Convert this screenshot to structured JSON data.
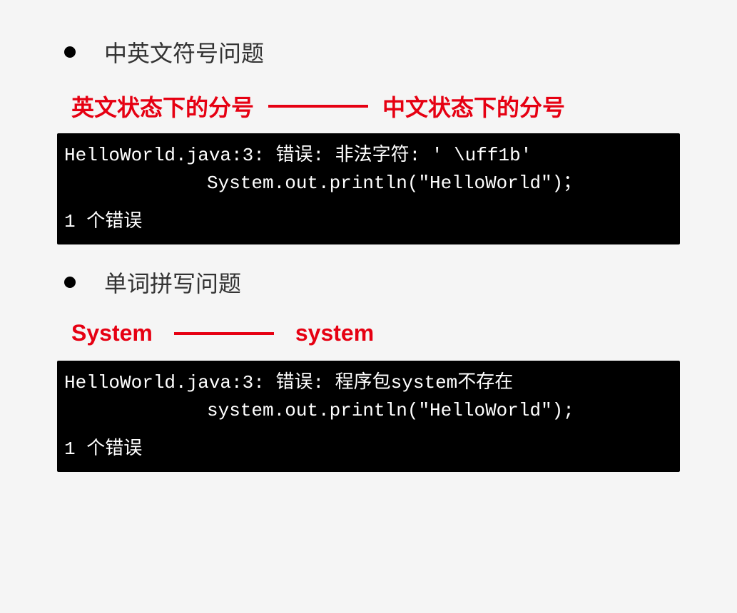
{
  "section1": {
    "bullet": "中英文符号问题",
    "left_label": "英文状态下的分号",
    "right_label": "中文状态下的分号",
    "terminal": {
      "line1": "HelloWorld.java:3: 错误: 非法字符: '\\＂ff1b'",
      "line1_display": "HelloWorld.java:3: 错误: 非法字符: ' \\uff1b'",
      "line2": "System.out.println(\"HelloWorld\")；",
      "line3": "1 个错误"
    }
  },
  "section2": {
    "bullet": "单词拼写问题",
    "left_label": "System",
    "right_label": "system",
    "terminal": {
      "line1": "HelloWorld.java:3: 错误: 程序包system不存在",
      "line2": "system.out.println(\"HelloWorld\");",
      "line3": "1 个错误"
    }
  }
}
